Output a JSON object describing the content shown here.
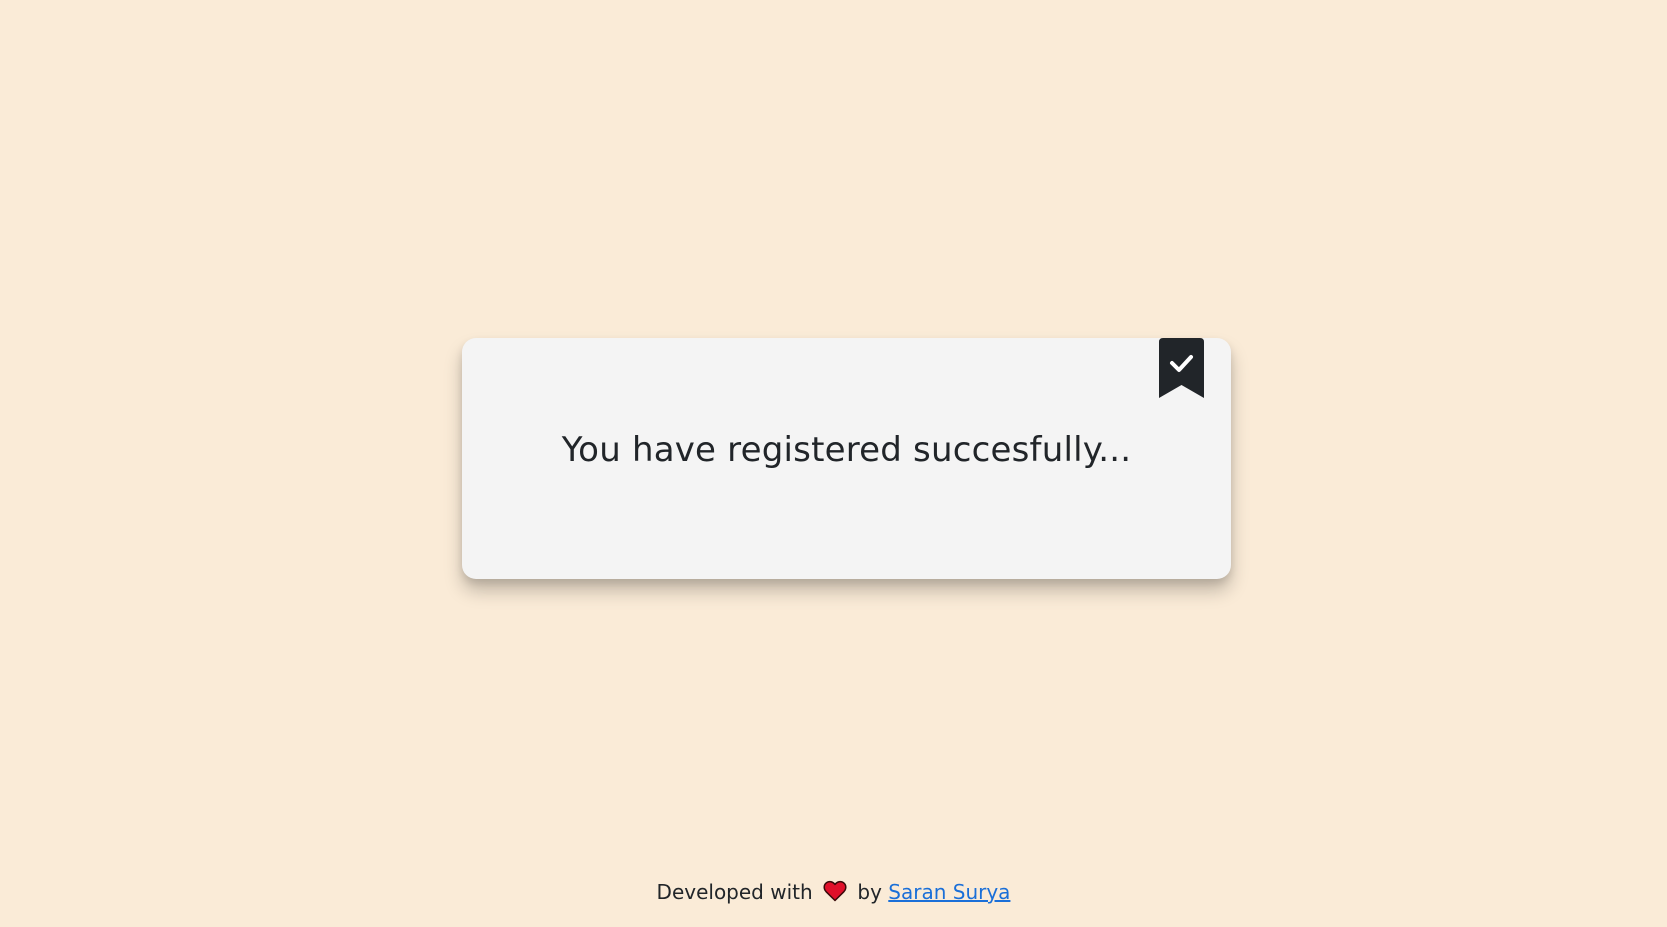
{
  "card": {
    "message": "You have registered succesfully...",
    "badge_icon": "bookmark-check-icon"
  },
  "footer": {
    "prefix": "Developed with",
    "heart_icon": "heart-icon",
    "by": "by",
    "author_link": "Saran Surya"
  },
  "colors": {
    "background": "#faebd7",
    "card": "#f4f4f4",
    "text": "#212529",
    "badge": "#212529",
    "heart": "#e0102a",
    "link": "#1a6fd8"
  }
}
